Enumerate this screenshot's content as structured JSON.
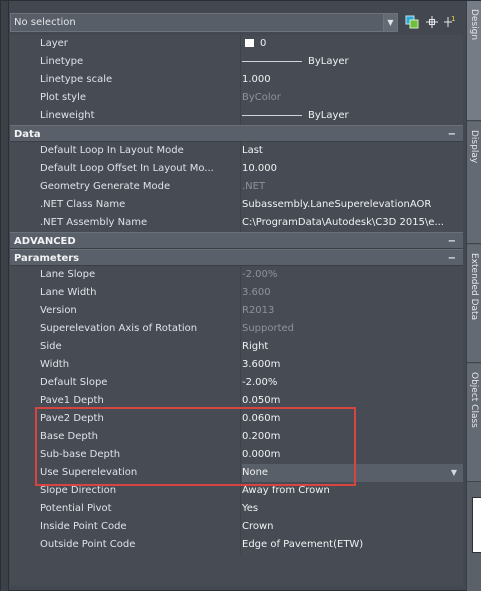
{
  "selector": {
    "value": "No selection"
  },
  "toolbar": {
    "icons": [
      "quick-select-icon",
      "select-objects-icon",
      "toggle-pickadd-icon"
    ]
  },
  "general": [
    {
      "label": "Layer",
      "value": "0",
      "kind": "layer"
    },
    {
      "label": "Linetype",
      "value": "ByLayer",
      "kind": "line"
    },
    {
      "label": "Linetype scale",
      "value": "1.000"
    },
    {
      "label": "Plot style",
      "value": "ByColor",
      "dim": true
    },
    {
      "label": "Lineweight",
      "value": "ByLayer",
      "kind": "line"
    }
  ],
  "sections": {
    "data": "Data",
    "advanced": "ADVANCED",
    "parameters": "Parameters",
    "collapse": "−"
  },
  "data_rows": [
    {
      "label": "Default Loop In Layout Mode",
      "value": "Last"
    },
    {
      "label": "Default Loop Offset In Layout Mo...",
      "value": "10.000"
    },
    {
      "label": "Geometry Generate Mode",
      "value": ".NET",
      "dim": true
    },
    {
      "label": ".NET Class Name",
      "value": "Subassembly.LaneSuperelevationAOR"
    },
    {
      "label": ".NET Assembly Name",
      "value": "C:\\ProgramData\\Autodesk\\C3D 2015\\e..."
    }
  ],
  "parameter_rows": [
    {
      "label": "Lane Slope",
      "value": "-2.00%",
      "dim": true
    },
    {
      "label": "Lane Width",
      "value": "3.600",
      "dim": true
    },
    {
      "label": "Version",
      "value": "R2013",
      "dim": true
    },
    {
      "label": "Superelevation Axis of Rotation",
      "value": "Supported",
      "dim": true
    },
    {
      "label": "Side",
      "value": "Right"
    },
    {
      "label": "Width",
      "value": "3.600m"
    },
    {
      "label": "Default Slope",
      "value": "-2.00%"
    },
    {
      "label": "Pave1 Depth",
      "value": "0.050m"
    },
    {
      "label": "Pave2 Depth",
      "value": "0.060m"
    },
    {
      "label": "Base Depth",
      "value": "0.200m"
    },
    {
      "label": "Sub-base Depth",
      "value": "0.000m"
    },
    {
      "label": "Use Superelevation",
      "value": "None",
      "kind": "drop"
    },
    {
      "label": "Slope Direction",
      "value": "Away from Crown"
    },
    {
      "label": "Potential Pivot",
      "value": "Yes"
    },
    {
      "label": "Inside Point Code",
      "value": "Crown"
    },
    {
      "label": "Outside Point Code",
      "value": "Edge of Pavement(ETW)"
    }
  ],
  "side_tabs": [
    "Design",
    "Display",
    "Extended Data",
    "Object Class"
  ],
  "colors": {
    "highlight": "#d8443f",
    "panel": "#474c54",
    "header": "#5a6069"
  }
}
